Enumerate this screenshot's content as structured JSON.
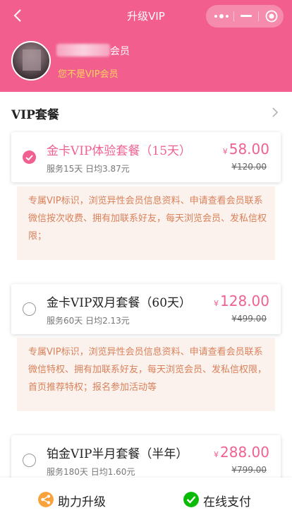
{
  "header": {
    "title": "升级VIP",
    "member_label": "会员",
    "status": "您不是VIP会员"
  },
  "section": {
    "title": "VIP套餐"
  },
  "plans": [
    {
      "name": "金卡VIP体验套餐（15天）",
      "sub": "服务15天 日均3.87元",
      "price": "58.00",
      "original": "¥120.00",
      "selected": true,
      "description": "专属VIP标识，浏览异性会员信息资料、申请查看会员联系微信按次收费、拥有加联系好友，每天浏览会员、发私信权限；"
    },
    {
      "name": "金卡VIP双月套餐（60天）",
      "sub": "服务60天 日均2.13元",
      "price": "128.00",
      "original": "¥499.00",
      "selected": false,
      "description": "专属VIP标识，浏览异性会员信息资料、申请查看会员联系微信特权、拥有加联系好友，每天浏览会员、发私信权限，首页推荐特权；报名参加活动等"
    },
    {
      "name": "铂金VIP半月套餐（半年）",
      "sub": "服务180天 日均1.60元",
      "price": "288.00",
      "original": "¥799.00",
      "selected": false
    }
  ],
  "currency": "¥",
  "bottom": {
    "assist_label": "助力升级",
    "pay_label": "在线支付"
  },
  "colors": {
    "brand": "#f25f8e",
    "price": "#f06191",
    "warning": "#ffd25e",
    "assist_icon": "#f9a23b",
    "pay_icon": "#09bb07"
  },
  "icons": {
    "back": "chevron-left-icon",
    "more": "more-dots-icon",
    "minimize": "minus-icon",
    "close": "target-circle-icon",
    "section": "chevron-right-icon",
    "assist": "share-icon",
    "pay": "wechat-pay-icon"
  }
}
